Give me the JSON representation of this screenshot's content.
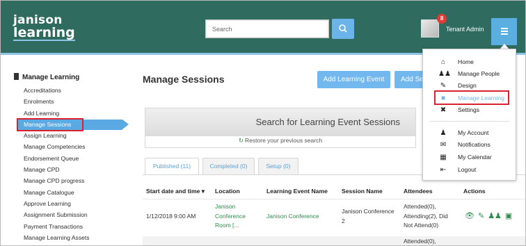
{
  "header": {
    "logo_line1": "janison",
    "logo_line2": "learning",
    "search_placeholder": "Search",
    "notification_count": "8",
    "user_name": "Tenant Admin"
  },
  "sidebar": {
    "title": "Manage Learning",
    "items": [
      {
        "label": "Accreditations"
      },
      {
        "label": "Enrolments"
      },
      {
        "label": "Add Learning"
      },
      {
        "label": "Manage Sessions"
      },
      {
        "label": "Assign Learning"
      },
      {
        "label": "Manage Competencies"
      },
      {
        "label": "Endorsement Queue"
      },
      {
        "label": "Manage CPD"
      },
      {
        "label": "Manage CPD progress"
      },
      {
        "label": "Manage Catalogue"
      },
      {
        "label": "Approve Learning"
      },
      {
        "label": "Assignment Submission"
      },
      {
        "label": "Payment Transactions"
      },
      {
        "label": "Manage Learning Assets"
      }
    ]
  },
  "main": {
    "title": "Manage Sessions",
    "add_event_label": "Add Learning Event",
    "add_session_label": "Add Se",
    "search_title": "Search for Learning Event Sessions",
    "restore_label": "Restore your previous search",
    "tabs": [
      {
        "label": "Published (11)"
      },
      {
        "label": "Completed (0)"
      },
      {
        "label": "Setup (0)"
      }
    ],
    "columns": {
      "start": "Start date and time ▾",
      "location": "Location",
      "event": "Learning Event Name",
      "session": "Session Name",
      "attendees": "Attendees",
      "actions": "Actions"
    },
    "rows": [
      {
        "start": "1/12/2018 9:00 AM",
        "location": [
          "Janison",
          "Conference",
          "Room [..."
        ],
        "event": "Janison Conference",
        "session": [
          "Janison Conference",
          "2"
        ],
        "attendees": [
          "Attended(0),",
          "Attending(2), Did",
          "Not Attend(0)"
        ]
      },
      {
        "attendees": [
          "Attended(0),"
        ]
      }
    ]
  },
  "menu": {
    "items": [
      {
        "label": "Home",
        "icon": "home-icon"
      },
      {
        "label": "Manage People",
        "icon": "people-icon"
      },
      {
        "label": "Design",
        "icon": "pencil-icon"
      },
      {
        "label": "Manage Learning",
        "icon": "book-icon"
      },
      {
        "label": "Settings",
        "icon": "tools-icon"
      },
      {
        "label": "My Account",
        "icon": "user-icon"
      },
      {
        "label": "Notifications",
        "icon": "envelope-icon"
      },
      {
        "label": "My Calendar",
        "icon": "calendar-icon"
      },
      {
        "label": "Logout",
        "icon": "logout-icon"
      }
    ]
  },
  "colors": {
    "header_bg": "#2f6b5f",
    "accent_blue": "#5aa9e3",
    "link_green": "#2e8c4a",
    "highlight_red": "#d8222e"
  }
}
